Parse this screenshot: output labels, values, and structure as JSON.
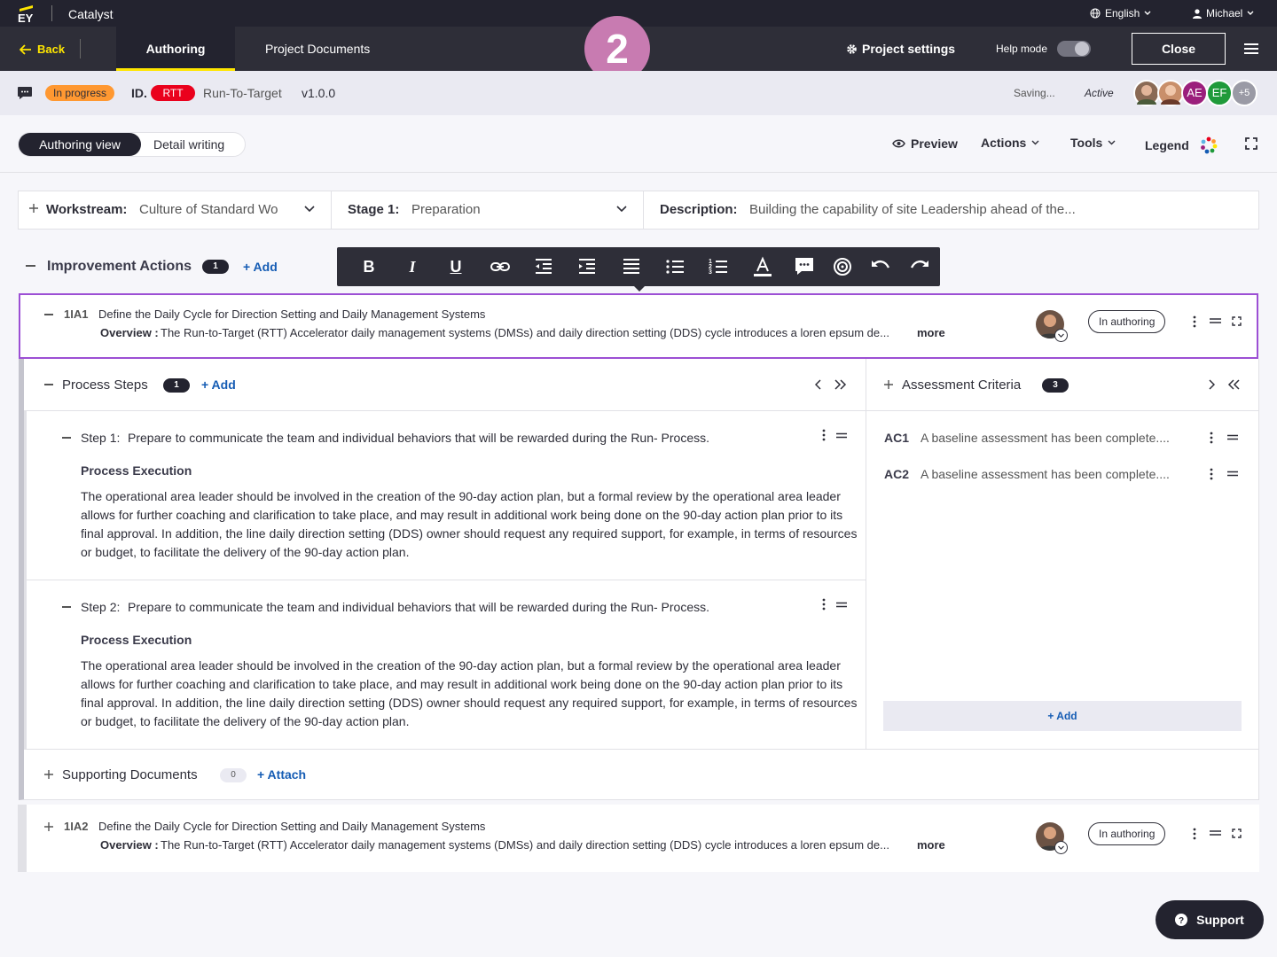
{
  "app": {
    "logo": "EY",
    "name": "Catalyst",
    "language": "English",
    "user": "Michael"
  },
  "nav": {
    "back": "Back",
    "tabs": [
      "Authoring",
      "Project Documents"
    ],
    "step_number": "2",
    "project_settings": "Project settings",
    "help_mode": "Help mode",
    "close": "Close"
  },
  "status": {
    "state": "In progress",
    "id_label": "ID.",
    "id_badge": "RTT",
    "project_name": "Run-To-Target",
    "version": "v1.0.0",
    "saving": "Saving...",
    "active": "Active",
    "avatars": [
      "AE",
      "EF",
      "+5"
    ]
  },
  "view": {
    "modes": [
      "Authoring view",
      "Detail writing"
    ],
    "preview": "Preview",
    "actions": "Actions",
    "tools": "Tools",
    "legend": "Legend"
  },
  "filters": {
    "workstream_label": "Workstream:",
    "workstream_value": "Culture of Standard Wo",
    "stage_label": "Stage 1:",
    "stage_value": "Preparation",
    "description_label": "Description:",
    "description_value": "Building the capability of site Leadership ahead of the..."
  },
  "improvement": {
    "title": "Improvement Actions",
    "count": "1",
    "add": "+ Add"
  },
  "actions": [
    {
      "id": "1IA1",
      "title": "Define the Daily Cycle for Direction Setting and Daily Management Systems",
      "overview_label": "Overview :",
      "overview": "The Run-to-Target (RTT) Accelerator daily management systems (DMSs) and daily direction setting (DDS) cycle introduces a loren epsum de...",
      "more": "more",
      "status": "In authoring"
    },
    {
      "id": "1IA2",
      "title": "Define the Daily Cycle for Direction Setting and Daily Management Systems",
      "overview_label": "Overview :",
      "overview": "The Run-to-Target (RTT) Accelerator daily management systems (DMSs) and daily direction setting (DDS) cycle introduces a loren epsum de...",
      "more": "more",
      "status": "In authoring"
    }
  ],
  "process": {
    "title": "Process Steps",
    "count": "1",
    "add": "+ Add",
    "steps": [
      {
        "label": "Step 1:",
        "text": "Prepare to communicate the team and individual behaviors that will be rewarded during the Run- Process.",
        "section": "Process Execution",
        "lines": [
          "The operational area leader should be involved in the creation of the 90-day action plan, but a formal review by the operational area leader",
          "allows for further coaching and clarification to take place, and may result in additional work being done on the 90-day action plan prior to its",
          "final approval. In addition, the line daily direction setting (DDS) owner should request any required support, for example, in terms of resources",
          "or budget, to facilitate the delivery of the 90-day action plan."
        ]
      },
      {
        "label": "Step 2:",
        "text": "Prepare to communicate the team and individual behaviors that will be rewarded during the Run- Process.",
        "section": "Process Execution",
        "lines": [
          "The operational area leader should be involved in the creation of the 90-day action plan, but a formal review by the operational area leader",
          "allows for further coaching and clarification to take place, and may result in additional work being done on the 90-day action plan prior to its",
          "final approval. In addition, the line daily direction setting (DDS) owner should request any required support, for example, in terms of resources",
          "or budget, to facilitate the delivery of the 90-day action plan."
        ]
      }
    ]
  },
  "assessment": {
    "title": "Assessment Criteria",
    "count": "3",
    "add": "+ Add",
    "items": [
      {
        "code": "AC1",
        "text": "A baseline assessment has been complete...."
      },
      {
        "code": "AC2",
        "text": "A baseline assessment has been complete...."
      }
    ]
  },
  "supporting": {
    "title": "Supporting Documents",
    "count": "0",
    "attach": "+ Attach"
  },
  "support": "Support",
  "colors": {
    "accent": "#ffe600",
    "purple": "#b9256e",
    "rtt_red": "#ea011d",
    "progress_orange": "#ff9831",
    "dark": "#2e2e38",
    "link": "#155cb4"
  }
}
